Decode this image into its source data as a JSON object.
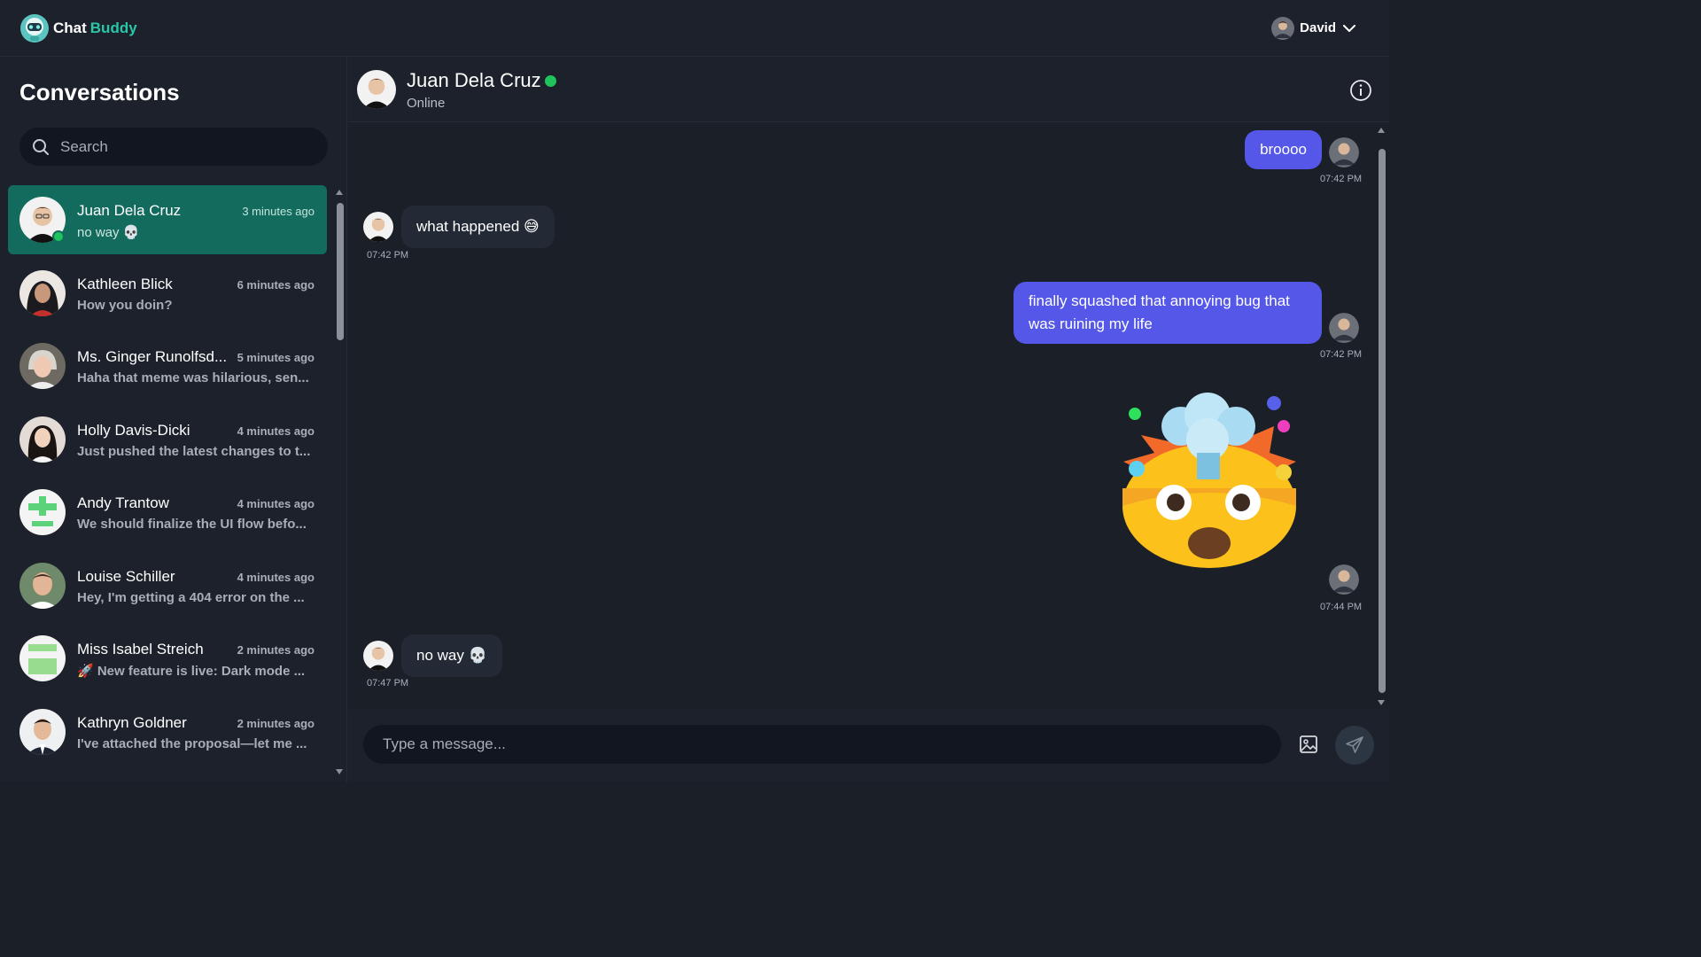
{
  "app": {
    "brand_part1": "Chat",
    "brand_part2": "Buddy",
    "accent": "#2bc6a8"
  },
  "user_menu": {
    "name": "David",
    "icon": "chevron-down-icon"
  },
  "sidebar": {
    "title": "Conversations",
    "search_placeholder": "Search",
    "conversations": [
      {
        "name": "Juan Dela Cruz",
        "time": "3 minutes ago",
        "preview": "no way 💀",
        "active": true,
        "online": true
      },
      {
        "name": "Kathleen Blick",
        "time": "6 minutes ago",
        "preview": "How you doin?"
      },
      {
        "name": "Ms. Ginger Runolfsd...",
        "time": "5 minutes ago",
        "preview": "Haha that meme was hilarious, sen..."
      },
      {
        "name": "Holly Davis-Dicki",
        "time": "4 minutes ago",
        "preview": "Just pushed the latest changes to t..."
      },
      {
        "name": "Andy Trantow",
        "time": "4 minutes ago",
        "preview": "We should finalize the UI flow befo..."
      },
      {
        "name": "Louise Schiller",
        "time": "4 minutes ago",
        "preview": "Hey, I'm getting a 404 error on the ..."
      },
      {
        "name": "Miss Isabel Streich",
        "time": "2 minutes ago",
        "preview": "🚀 New feature is live: Dark mode ..."
      },
      {
        "name": "Kathryn Goldner",
        "time": "2 minutes ago",
        "preview": "I've attached the proposal—let me ..."
      }
    ]
  },
  "chat": {
    "contact_name": "Juan Dela Cruz",
    "status": "Online",
    "messages": [
      {
        "dir": "out",
        "text": "broooo",
        "time": "07:42 PM"
      },
      {
        "dir": "in",
        "text": "what happened 😅",
        "time": "07:42 PM"
      },
      {
        "dir": "out",
        "text": "finally squashed that annoying bug that was ruining my life",
        "time": "07:42 PM"
      },
      {
        "dir": "out",
        "text": "🤯",
        "time": "07:44 PM",
        "kind": "emoji-sticker"
      },
      {
        "dir": "in",
        "text": "no way 💀",
        "time": "07:47 PM"
      }
    ]
  },
  "composer": {
    "placeholder": "Type a message..."
  }
}
